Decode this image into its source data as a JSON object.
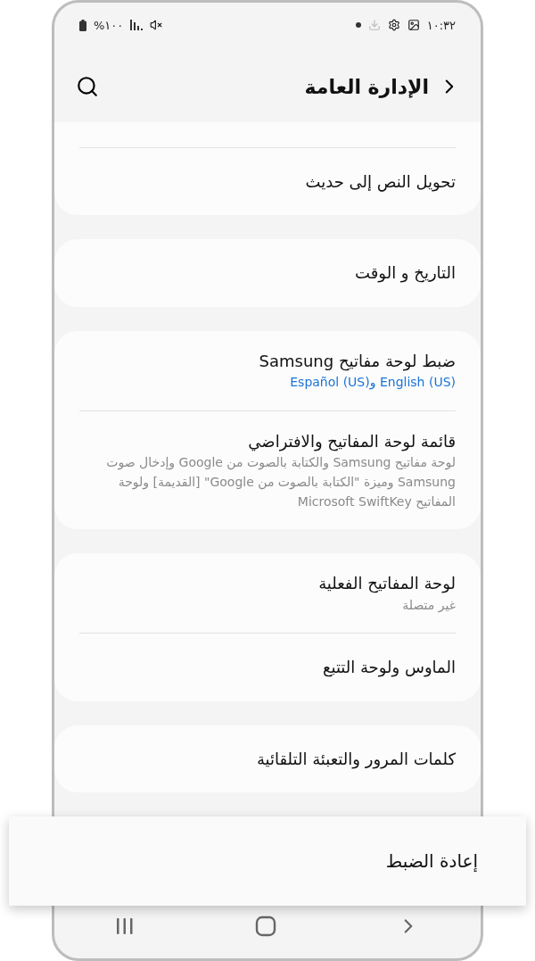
{
  "status_bar": {
    "time": "١٠:٣٢",
    "battery": "%١٠٠"
  },
  "header": {
    "title": "الإدارة العامة"
  },
  "groups": [
    {
      "clipped_top": true,
      "items": [
        {
          "title": "تحويل النص إلى حديث"
        }
      ]
    },
    {
      "items": [
        {
          "title": "التاريخ و الوقت"
        }
      ]
    },
    {
      "items": [
        {
          "title": "ضبط لوحة مفاتيح Samsung",
          "subtitle": "English (US) وEspañol (US)",
          "kind": "link"
        },
        {
          "title": "قائمة لوحة المفاتيح والافتراضي",
          "subtitle": "لوحة مفاتيح Samsung والكتابة بالصوت من Google وإدخال صوت Samsung وميزة \"الكتابة بالصوت من Google\" [القديمة] ولوحة المفاتيح Microsoft SwiftKey",
          "kind": "plain"
        }
      ]
    },
    {
      "items": [
        {
          "title": "لوحة المفاتيح الفعلية",
          "subtitle": "غير متصلة",
          "kind": "plain"
        },
        {
          "title": "الماوس ولوحة التتبع"
        }
      ]
    },
    {
      "items": [
        {
          "title": "كلمات المرور والتعبئة التلقائية"
        }
      ]
    }
  ],
  "highlight": {
    "title": "إعادة الضبط"
  }
}
